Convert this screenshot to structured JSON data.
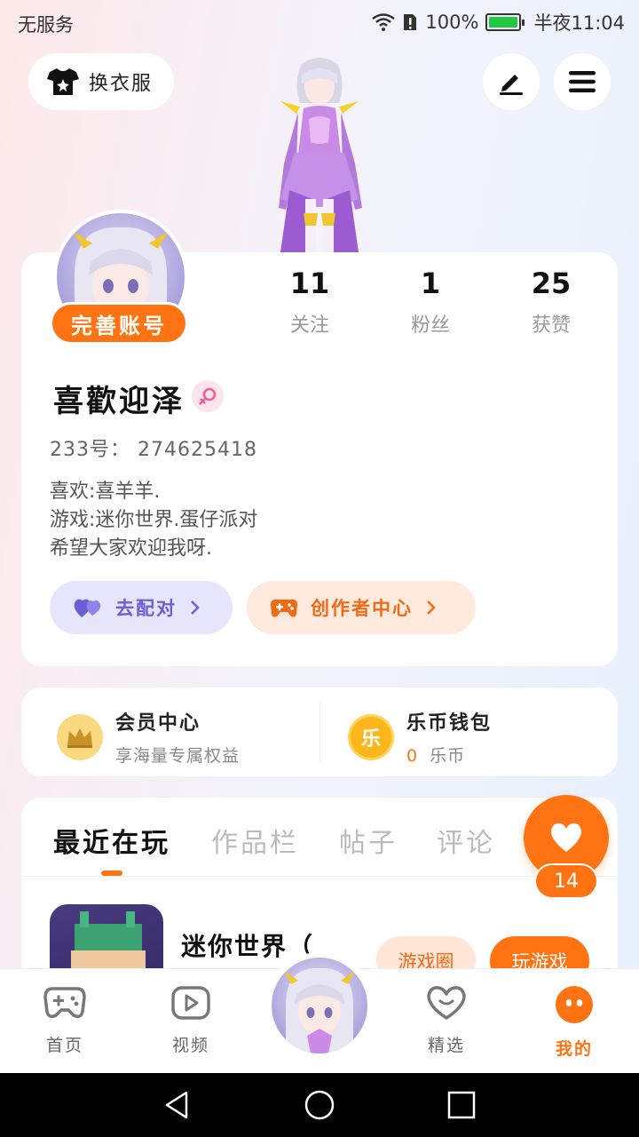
{
  "status_bar": {
    "carrier": "无服务",
    "battery": "100%",
    "time": "半夜11:04"
  },
  "header": {
    "outfit_label": "换衣服"
  },
  "profile": {
    "complete_account_label": "完善账号",
    "stats": [
      {
        "value": "11",
        "label": "关注"
      },
      {
        "value": "1",
        "label": "粉丝"
      },
      {
        "value": "25",
        "label": "获赞"
      }
    ],
    "nickname": "喜歡迎泽",
    "user_id": "233号： 274625418",
    "bio_lines": [
      "喜欢:喜羊羊.",
      "游戏:迷你世界.蛋仔派对",
      "希望大家欢迎我呀."
    ],
    "pair_label": "去配对",
    "creator_label": "创作者中心"
  },
  "member": {
    "vip_title": "会员中心",
    "vip_sub": "享海量专属权益",
    "wallet_title": "乐币钱包",
    "wallet_amount": "0",
    "wallet_unit": "乐币",
    "coin_glyph": "乐"
  },
  "tabs": [
    {
      "label": "最近在玩",
      "active": true
    },
    {
      "label": "作品栏"
    },
    {
      "label": "帖子"
    },
    {
      "label": "评论"
    }
  ],
  "recent_game": {
    "title": "迷你世界（",
    "circle_label": "游戏圈",
    "play_label": "玩游戏"
  },
  "like": {
    "count": "14"
  },
  "bottom_nav": [
    {
      "label": "首页",
      "icon": "gamepad-icon"
    },
    {
      "label": "视频",
      "icon": "video-icon"
    },
    {
      "label": "精选",
      "icon": "heart-icon"
    },
    {
      "label": "我的",
      "icon": "me-icon",
      "active": true
    }
  ],
  "colors": {
    "accent": "#ff7312",
    "pair": "#6b5fd9",
    "bg_left": "#fde9ea",
    "bg_right": "#e7f1fd"
  }
}
